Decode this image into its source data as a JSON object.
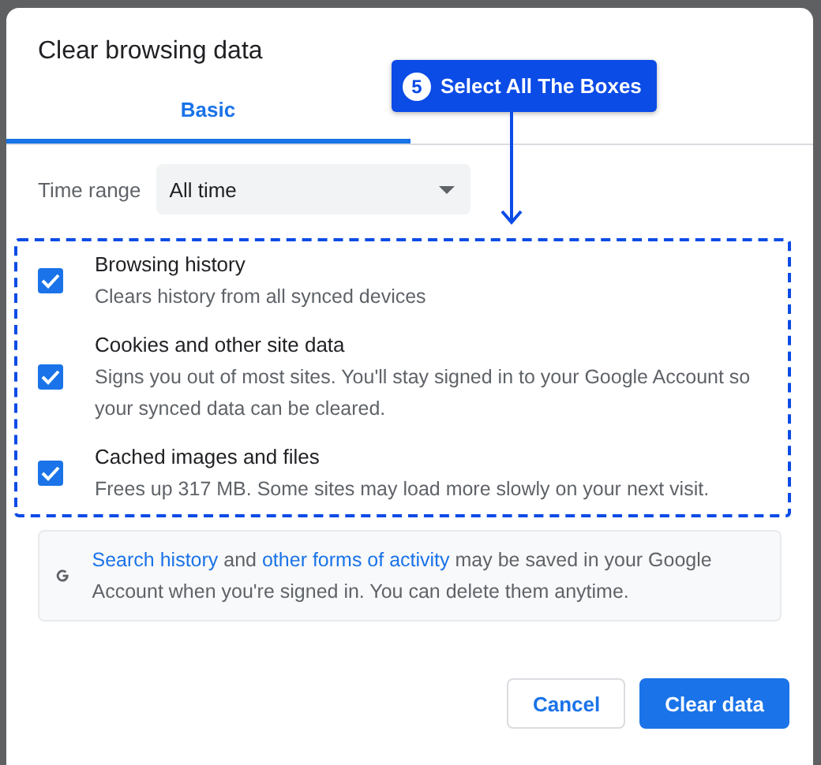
{
  "dialog": {
    "title": "Clear browsing data",
    "tabs": [
      {
        "label": "Basic",
        "selected": true
      },
      {
        "selected": false
      }
    ],
    "time_range": {
      "label": "Time range",
      "value": "All time"
    },
    "options": [
      {
        "title": "Browsing history",
        "description": "Clears history from all synced devices",
        "checked": true
      },
      {
        "title": "Cookies and other site data",
        "description": "Signs you out of most sites. You'll stay signed in to your Google Account so your synced data can be cleared.",
        "checked": true
      },
      {
        "title": "Cached images and files",
        "description": "Frees up 317 MB. Some sites may load more slowly on your next visit.",
        "checked": true
      }
    ],
    "notice": {
      "link_1": "Search history",
      "text_1": " and ",
      "link_2": "other forms of activity",
      "text_2": " may be saved in your Google Account when you're signed in. You can delete them anytime."
    },
    "buttons": [
      {
        "label": "Cancel",
        "kind": "secondary"
      },
      {
        "label": "Clear data",
        "kind": "primary"
      }
    ]
  },
  "callout": {
    "step": "5",
    "text": "Select All The Boxes"
  }
}
